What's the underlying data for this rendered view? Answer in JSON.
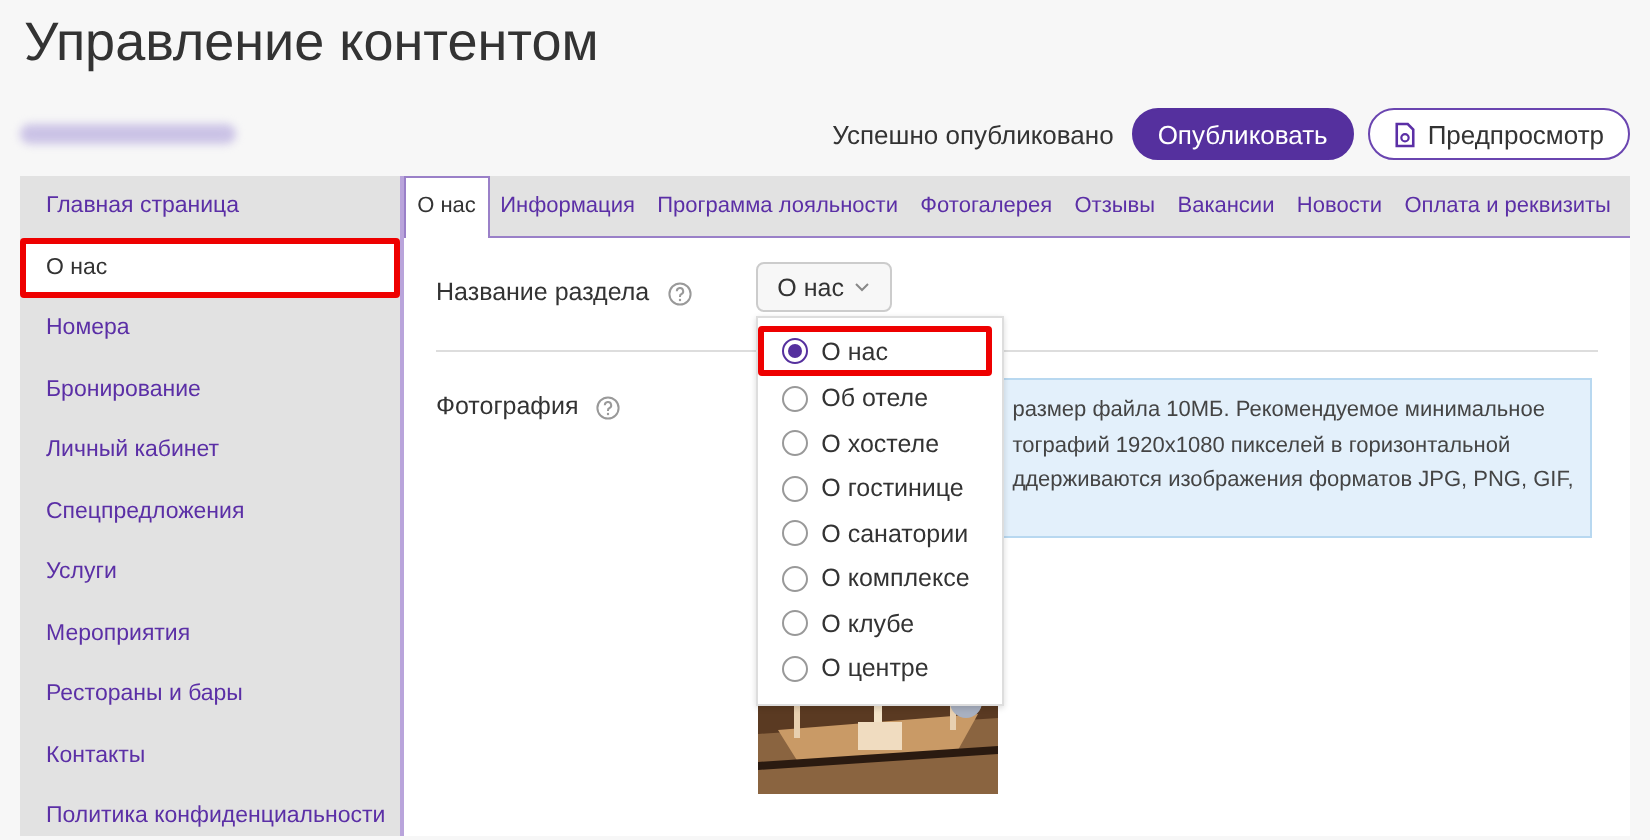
{
  "title": "Управление контентом",
  "status": "Успешно опубликовано",
  "buttons": [
    {
      "kind": "primary",
      "label": "Опубликовать"
    },
    {
      "kind": "preview",
      "label": "Предпросмотр"
    }
  ],
  "sidebar": {
    "items": [
      {
        "label": "Главная страница",
        "selected": false
      },
      {
        "label": "О нас",
        "selected": true
      },
      {
        "label": "Номера",
        "selected": false
      },
      {
        "label": "Бронирование",
        "selected": false
      },
      {
        "label": "Личный кабинет",
        "selected": false
      },
      {
        "label": "Спецпредложения",
        "selected": false
      },
      {
        "label": "Услуги",
        "selected": false
      },
      {
        "label": "Мероприятия",
        "selected": false
      },
      {
        "label": "Рестораны и бары",
        "selected": false
      },
      {
        "label": "Контакты",
        "selected": false
      },
      {
        "label": "Политика конфиденциальности",
        "selected": false
      }
    ]
  },
  "tabs": [
    {
      "label": "О нас",
      "selected": true
    },
    {
      "label": "Информация",
      "selected": false
    },
    {
      "label": "Программа лояльности",
      "selected": false
    },
    {
      "label": "Фотогалерея",
      "selected": false
    },
    {
      "label": "Отзывы",
      "selected": false
    },
    {
      "label": "Вакансии",
      "selected": false
    },
    {
      "label": "Новости",
      "selected": false
    },
    {
      "label": "Оплата и реквизиты",
      "selected": false
    }
  ],
  "section_name": {
    "label": "Название раздела",
    "value": "О нас",
    "options": [
      {
        "label": "О нас",
        "selected": true
      },
      {
        "label": "Об отеле",
        "selected": false
      },
      {
        "label": "О хостеле",
        "selected": false
      },
      {
        "label": "О гостинице",
        "selected": false
      },
      {
        "label": "О санатории",
        "selected": false
      },
      {
        "label": "О комплексе",
        "selected": false
      },
      {
        "label": "О клубе",
        "selected": false
      },
      {
        "label": "О центре",
        "selected": false
      }
    ]
  },
  "photo": {
    "label": "Фотография",
    "info_lines": [
      "размер файла 10МБ. Рекомендуемое минимальное",
      "тографий 1920x1080 пикселей в горизонтальной",
      "ддерживаются изображения форматов JPG, PNG, GIF,"
    ]
  }
}
